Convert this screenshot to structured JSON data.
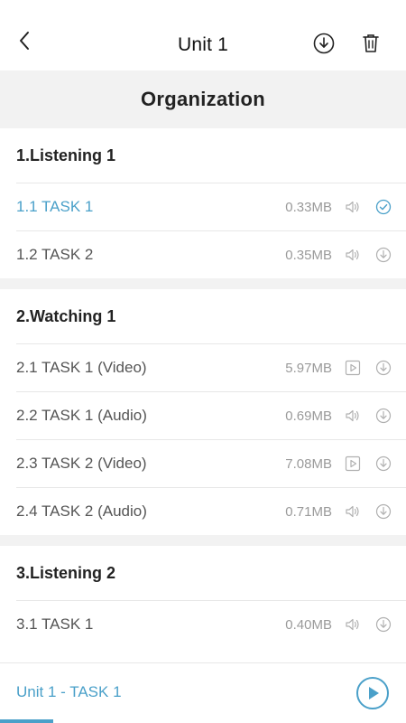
{
  "header": {
    "title": "Unit 1",
    "back_icon": "back-chevron-icon",
    "download_all_icon": "download-icon",
    "delete_icon": "trash-icon"
  },
  "subheader": {
    "title": "Organization"
  },
  "groups": [
    {
      "title": "1.Listening 1",
      "items": [
        {
          "label": "1.1 TASK 1",
          "size": "0.33MB",
          "media": "audio",
          "status": "downloaded",
          "active": true
        },
        {
          "label": "1.2 TASK 2",
          "size": "0.35MB",
          "media": "audio",
          "status": "download",
          "active": false
        }
      ]
    },
    {
      "title": "2.Watching 1",
      "items": [
        {
          "label": "2.1 TASK 1 (Video)",
          "size": "5.97MB",
          "media": "video",
          "status": "download",
          "active": false
        },
        {
          "label": "2.2 TASK 1 (Audio)",
          "size": "0.69MB",
          "media": "audio",
          "status": "download",
          "active": false
        },
        {
          "label": "2.3 TASK 2 (Video)",
          "size": "7.08MB",
          "media": "video",
          "status": "download",
          "active": false
        },
        {
          "label": "2.4 TASK 2 (Audio)",
          "size": "0.71MB",
          "media": "audio",
          "status": "download",
          "active": false
        }
      ]
    },
    {
      "title": "3.Listening 2",
      "items": [
        {
          "label": "3.1 TASK 1",
          "size": "0.40MB",
          "media": "audio",
          "status": "download",
          "active": false
        }
      ]
    }
  ],
  "player": {
    "now_playing": "Unit 1 - TASK 1",
    "progress": 0.13,
    "play_icon": "play-circle-icon"
  },
  "colors": {
    "accent": "#4aa0c9",
    "muted": "#9a9a9a",
    "band": "#f2f2f2"
  }
}
